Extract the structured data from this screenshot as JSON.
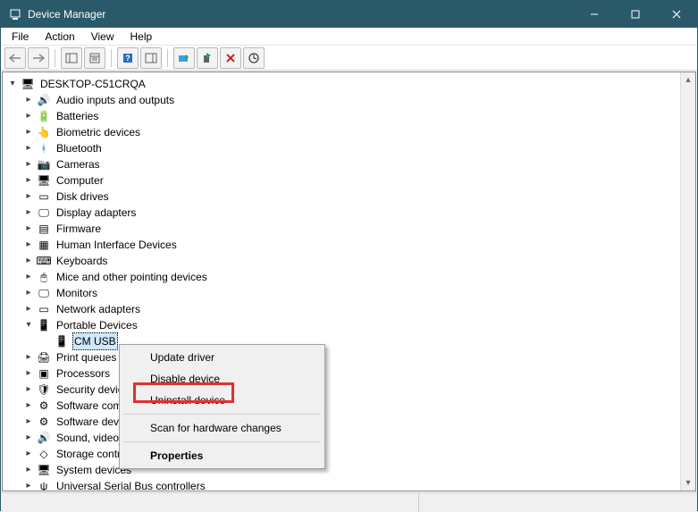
{
  "window": {
    "title": "Device Manager"
  },
  "menubar": [
    "File",
    "Action",
    "View",
    "Help"
  ],
  "tree": {
    "root": "DESKTOP-C51CRQA",
    "items": [
      {
        "label": "Audio inputs and outputs",
        "icon": "🔊"
      },
      {
        "label": "Batteries",
        "icon": "🔋"
      },
      {
        "label": "Biometric devices",
        "icon": "👆"
      },
      {
        "label": "Bluetooth",
        "icon": "ᚼ",
        "color": "#0a63c2"
      },
      {
        "label": "Cameras",
        "icon": "📷"
      },
      {
        "label": "Computer",
        "icon": "🖥"
      },
      {
        "label": "Disk drives",
        "icon": "▭"
      },
      {
        "label": "Display adapters",
        "icon": "🖵"
      },
      {
        "label": "Firmware",
        "icon": "▤"
      },
      {
        "label": "Human Interface Devices",
        "icon": "▦"
      },
      {
        "label": "Keyboards",
        "icon": "⌨"
      },
      {
        "label": "Mice and other pointing devices",
        "icon": "🖱"
      },
      {
        "label": "Monitors",
        "icon": "🖵"
      },
      {
        "label": "Network adapters",
        "icon": "▭"
      },
      {
        "label": "Portable Devices",
        "icon": "📱",
        "expanded": true,
        "children": [
          {
            "label": "CM USB",
            "icon": "📱",
            "selected": true
          }
        ]
      },
      {
        "label": "Print queues",
        "icon": "🖨"
      },
      {
        "label": "Processors",
        "icon": "▣"
      },
      {
        "label": "Security devices",
        "icon": "🛡"
      },
      {
        "label": "Software components",
        "icon": "⚙"
      },
      {
        "label": "Software devices",
        "icon": "⚙"
      },
      {
        "label": "Sound, video and game controllers",
        "icon": "🔊"
      },
      {
        "label": "Storage controllers",
        "icon": "◇"
      },
      {
        "label": "System devices",
        "icon": "🖥"
      },
      {
        "label": "Universal Serial Bus controllers",
        "icon": "ψ"
      }
    ]
  },
  "context_menu": {
    "items": [
      {
        "label": "Update driver"
      },
      {
        "label": "Disable device"
      },
      {
        "label": "Uninstall device",
        "highlighted": true
      },
      {
        "sep": true
      },
      {
        "label": "Scan for hardware changes"
      },
      {
        "sep": true
      },
      {
        "label": "Properties",
        "bold": true
      }
    ]
  }
}
